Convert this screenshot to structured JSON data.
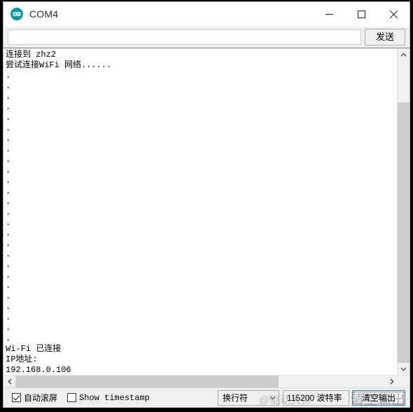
{
  "window": {
    "title": "COM4",
    "app_icon": "arduino-infinity-icon",
    "caption": {
      "minimize": "minimize-icon",
      "maximize": "maximize-icon",
      "close": "close-icon"
    }
  },
  "send_row": {
    "input_value": "",
    "input_placeholder": "",
    "send_label": "发送"
  },
  "console": {
    "lines": [
      "连接到 zhz2",
      "尝试连接WiFi 网络......",
      ".",
      ".",
      ".",
      ".",
      ".",
      ".",
      ".",
      ".",
      ".",
      ".",
      ".",
      ".",
      ".",
      ".",
      ".",
      ".",
      ".",
      ".",
      ".",
      ".",
      ".",
      ".",
      ".",
      ".",
      ".",
      ".",
      "Wi-Fi 已连接",
      "IP地址:",
      "192.168.0.106"
    ]
  },
  "scrollbars": {
    "vertical_up": "chevron-up-icon",
    "vertical_down": "chevron-down-icon",
    "horizontal_left": "chevron-left-icon",
    "horizontal_right": "chevron-right-icon"
  },
  "bottom_bar": {
    "autoscroll": {
      "label": "自动滚屏",
      "checked": true
    },
    "show_timestamp": {
      "label": "Show timestamp",
      "checked": false
    },
    "newline_select": {
      "value": "换行符",
      "arrow": "chevron-down-icon"
    },
    "baud_select": {
      "value": "115200 波特率"
    },
    "clear_button": {
      "label": "清空输出"
    }
  },
  "watermark": {
    "text": "清空输出",
    "secondary": "@驱动大师"
  },
  "colors": {
    "accent_teal": "#03989e",
    "focus_blue": "#3a76c8",
    "chrome_gray": "#f0f0f0",
    "scroll_thumb": "#cdcdcd"
  }
}
